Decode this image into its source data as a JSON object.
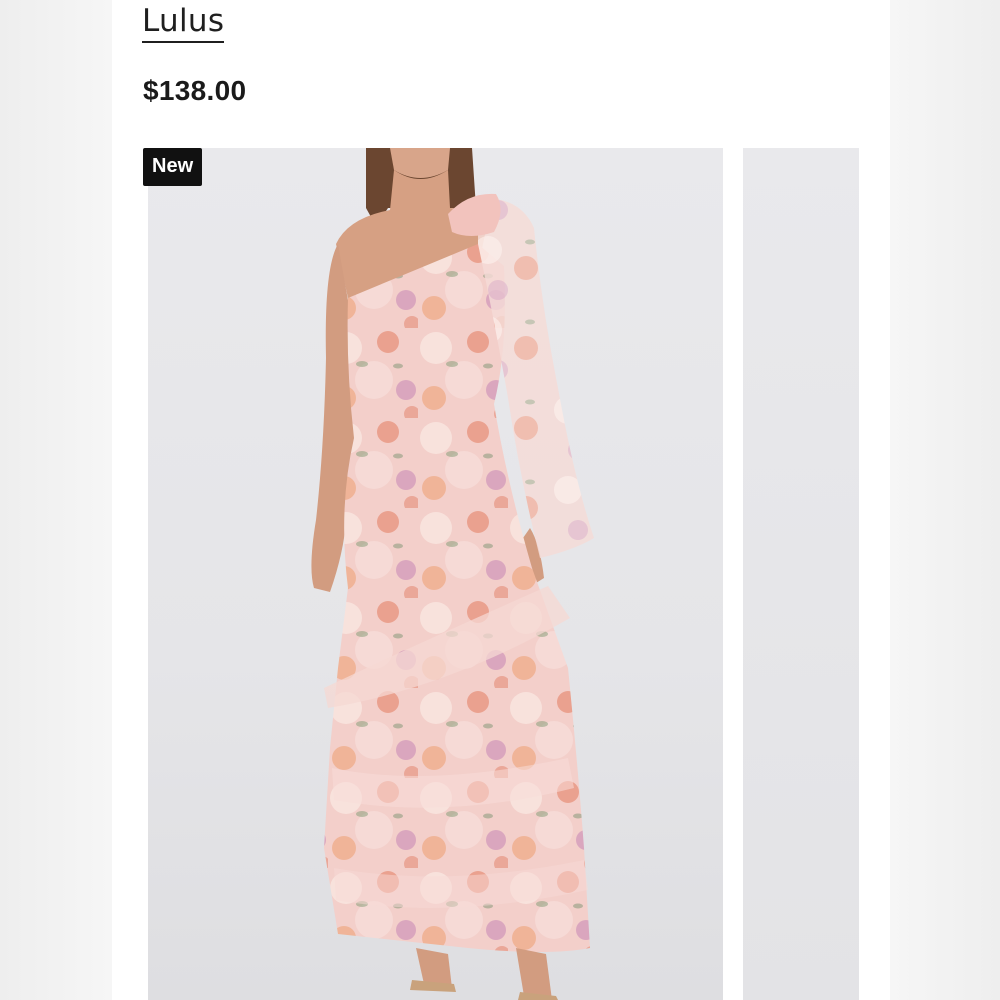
{
  "product": {
    "brand": "Lulus",
    "price": "$138.00",
    "badge": "New"
  },
  "gallery": {
    "main_image_subject": "model-wearing-one-shoulder-floral-maxi-dress",
    "next_image_subject": "partial-next-product-photo"
  },
  "colors": {
    "text": "#1f1f1f",
    "badge_bg": "#111111",
    "badge_text": "#ffffff",
    "photo_bg": "#e7e7ea",
    "dress_base": "#f1c6c3",
    "dress_accent": "#e08a6e"
  }
}
